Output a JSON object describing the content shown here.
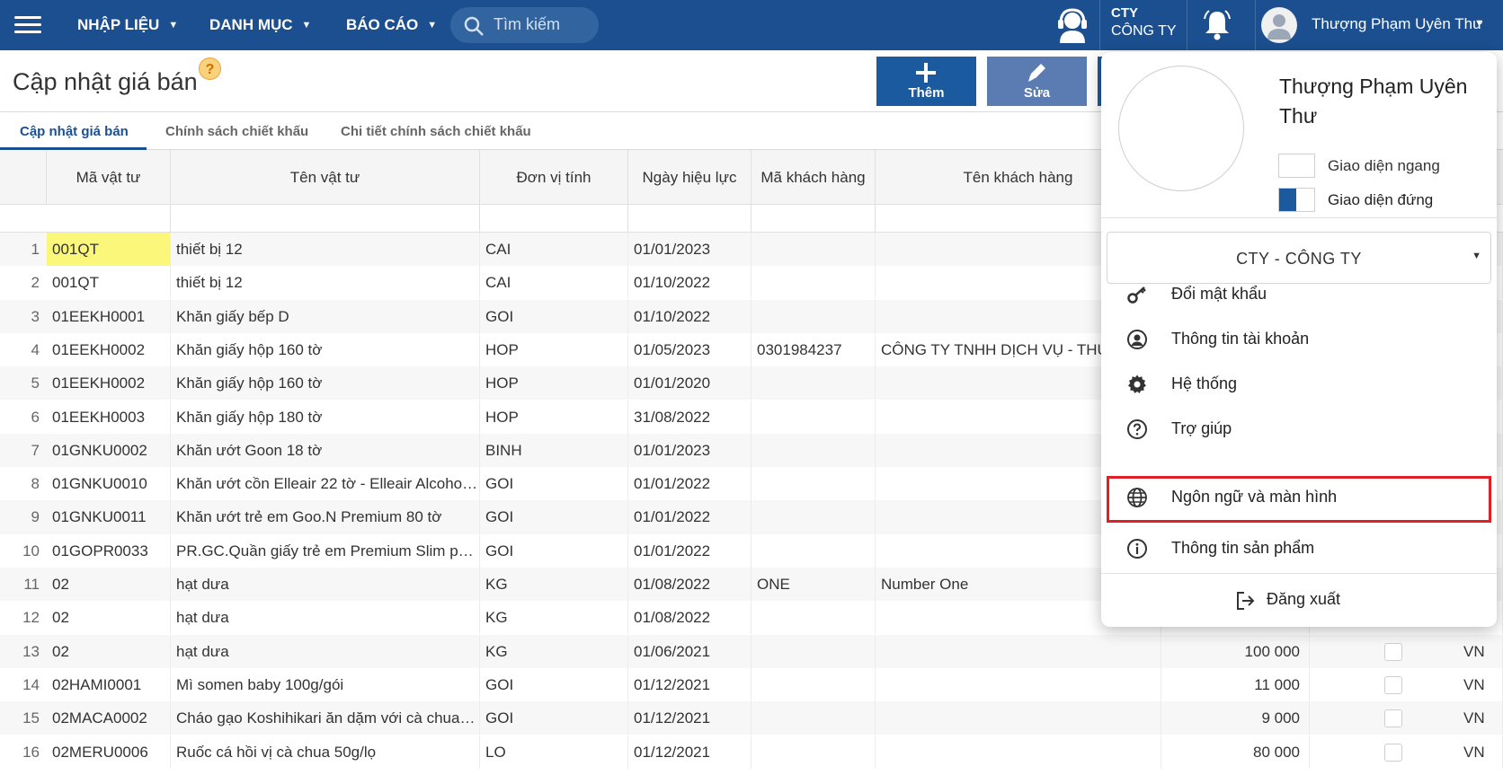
{
  "topbar": {
    "nav": [
      {
        "label": "NHẬP LIỆU"
      },
      {
        "label": "DANH MỤC"
      },
      {
        "label": "BÁO CÁO"
      }
    ],
    "search_placeholder": "Tìm kiếm",
    "company_code": "CTY",
    "company_name": "CÔNG TY",
    "user_name": "Thượng Phạm Uyên Thư"
  },
  "page": {
    "title": "Cập nhật giá bán",
    "help_icon": "?",
    "buttons": {
      "add": "Thêm",
      "edit": "Sửa"
    }
  },
  "tabs": [
    {
      "label": "Cập nhật giá bán",
      "active": true
    },
    {
      "label": "Chính sách chiết khấu",
      "active": false
    },
    {
      "label": "Chi tiết chính sách chiết khấu",
      "active": false
    }
  ],
  "grid": {
    "columns": [
      "Mã vật tư",
      "Tên vật tư",
      "Đơn vị tính",
      "Ngày hiệu lực",
      "Mã khách hàng",
      "Tên khách hàng"
    ],
    "rows": [
      {
        "no": "1",
        "code": "001QT",
        "name": "thiết bị 12",
        "unit": "CAI",
        "date": "01/01/2023",
        "cust_code": "",
        "cust_name": "",
        "price": "",
        "currency": ""
      },
      {
        "no": "2",
        "code": "001QT",
        "name": "thiết bị 12",
        "unit": "CAI",
        "date": "01/10/2022",
        "cust_code": "",
        "cust_name": "",
        "price": "",
        "currency": ""
      },
      {
        "no": "3",
        "code": "01EEKH0001",
        "name": "Khăn giấy bếp D",
        "unit": "GOI",
        "date": "01/10/2022",
        "cust_code": "",
        "cust_name": "",
        "price": "",
        "currency": ""
      },
      {
        "no": "4",
        "code": "01EEKH0002",
        "name": "Khăn giấy hộp 160 tờ",
        "unit": "HOP",
        "date": "01/05/2023",
        "cust_code": "0301984237",
        "cust_name": "CÔNG TY TNHH DỊCH VỤ - THƯƠNG MẠI",
        "price": "",
        "currency": ""
      },
      {
        "no": "5",
        "code": "01EEKH0002",
        "name": "Khăn giấy hộp 160 tờ",
        "unit": "HOP",
        "date": "01/01/2020",
        "cust_code": "",
        "cust_name": "",
        "price": "",
        "currency": ""
      },
      {
        "no": "6",
        "code": "01EEKH0003",
        "name": "Khăn giấy hộp 180 tờ",
        "unit": "HOP",
        "date": "31/08/2022",
        "cust_code": "",
        "cust_name": "",
        "price": "",
        "currency": ""
      },
      {
        "no": "7",
        "code": "01GNKU0002",
        "name": "Khăn ướt Goon 18 tờ",
        "unit": "BINH",
        "date": "01/01/2023",
        "cust_code": "",
        "cust_name": "",
        "price": "",
        "currency": ""
      },
      {
        "no": "8",
        "code": "01GNKU0010",
        "name": "Khăn ướt cồn Elleair 22 tờ - Elleair Alcohol ...",
        "unit": "GOI",
        "date": "01/01/2022",
        "cust_code": "",
        "cust_name": "",
        "price": "",
        "currency": ""
      },
      {
        "no": "9",
        "code": "01GNKU0011",
        "name": "Khăn ướt trẻ em Goo.N Premium 80 tờ",
        "unit": "GOI",
        "date": "01/01/2022",
        "cust_code": "",
        "cust_name": "",
        "price": "",
        "currency": ""
      },
      {
        "no": "10",
        "code": "01GOPR0033",
        "name": "PR.GC.Quần giấy trẻ em Premium Slim pant...",
        "unit": "GOI",
        "date": "01/01/2022",
        "cust_code": "",
        "cust_name": "",
        "price": "",
        "currency": ""
      },
      {
        "no": "11",
        "code": "02",
        "name": "hạt dưa",
        "unit": "KG",
        "date": "01/08/2022",
        "cust_code": "ONE",
        "cust_name": "Number One",
        "price": "",
        "currency": ""
      },
      {
        "no": "12",
        "code": "02",
        "name": "hạt dưa",
        "unit": "KG",
        "date": "01/08/2022",
        "cust_code": "",
        "cust_name": "",
        "price": "",
        "currency": ""
      },
      {
        "no": "13",
        "code": "02",
        "name": "hạt dưa",
        "unit": "KG",
        "date": "01/06/2021",
        "cust_code": "",
        "cust_name": "",
        "price": "100 000",
        "currency": "VN"
      },
      {
        "no": "14",
        "code": "02HAMI0001",
        "name": "Mì somen baby 100g/gói",
        "unit": "GOI",
        "date": "01/12/2021",
        "cust_code": "",
        "cust_name": "",
        "price": "11 000",
        "currency": "VN"
      },
      {
        "no": "15",
        "code": "02MACA0002",
        "name": "Cháo gạo Koshihikari ăn dặm với cà chua c...",
        "unit": "GOI",
        "date": "01/12/2021",
        "cust_code": "",
        "cust_name": "",
        "price": "9 000",
        "currency": "VN"
      },
      {
        "no": "16",
        "code": "02MERU0006",
        "name": "Ruốc cá hồi vị cà chua 50g/lọ",
        "unit": "LO",
        "date": "01/12/2021",
        "cust_code": "",
        "cust_name": "",
        "price": "80 000",
        "currency": "VN"
      }
    ]
  },
  "user_menu": {
    "name": "Thượng Phạm Uyên Thư",
    "layout_horizontal": "Giao diện ngang",
    "layout_vertical": "Giao diện đứng",
    "company": "CTY - CÔNG TY",
    "items": [
      {
        "label": "Đổi mật khẩu",
        "icon": "key-icon"
      },
      {
        "label": "Thông tin tài khoản",
        "icon": "account-icon"
      },
      {
        "label": "Hệ thống",
        "icon": "gear-icon"
      },
      {
        "label": "Trợ giúp",
        "icon": "help-circle-icon"
      },
      {
        "label": "Ngôn ngữ và màn hình",
        "icon": "globe-icon"
      },
      {
        "label": "Thông tin sản phẩm",
        "icon": "info-icon"
      }
    ],
    "logout": "Đăng xuất"
  },
  "colors": {
    "topbar": "#1c4f8f",
    "highlight_border": "#e01f26",
    "cell_highlight": "#fbf77a"
  }
}
